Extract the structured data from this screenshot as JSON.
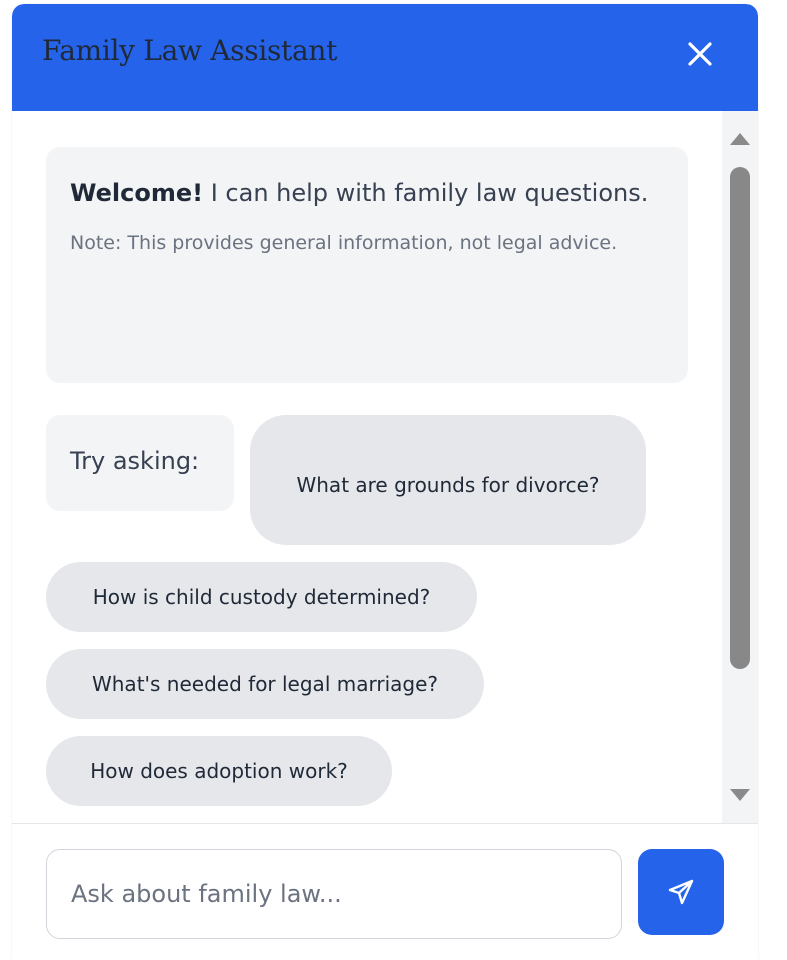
{
  "header": {
    "title": "Family Law Assistant",
    "close_icon": "close-icon",
    "bg_color": "#2563eb"
  },
  "welcome": {
    "bold": "Welcome!",
    "text": " I can help with family law questions.",
    "note": "Note: This provides general information, not legal advice."
  },
  "suggestions": {
    "prompt": "Try asking:",
    "items": [
      "What are grounds for divorce?",
      "How is child custody determined?",
      "What's needed for legal marriage?",
      "How does adoption work?"
    ]
  },
  "input": {
    "placeholder": "Ask about family law...",
    "value": ""
  },
  "send": {
    "icon": "send-icon",
    "color": "#2563eb"
  }
}
